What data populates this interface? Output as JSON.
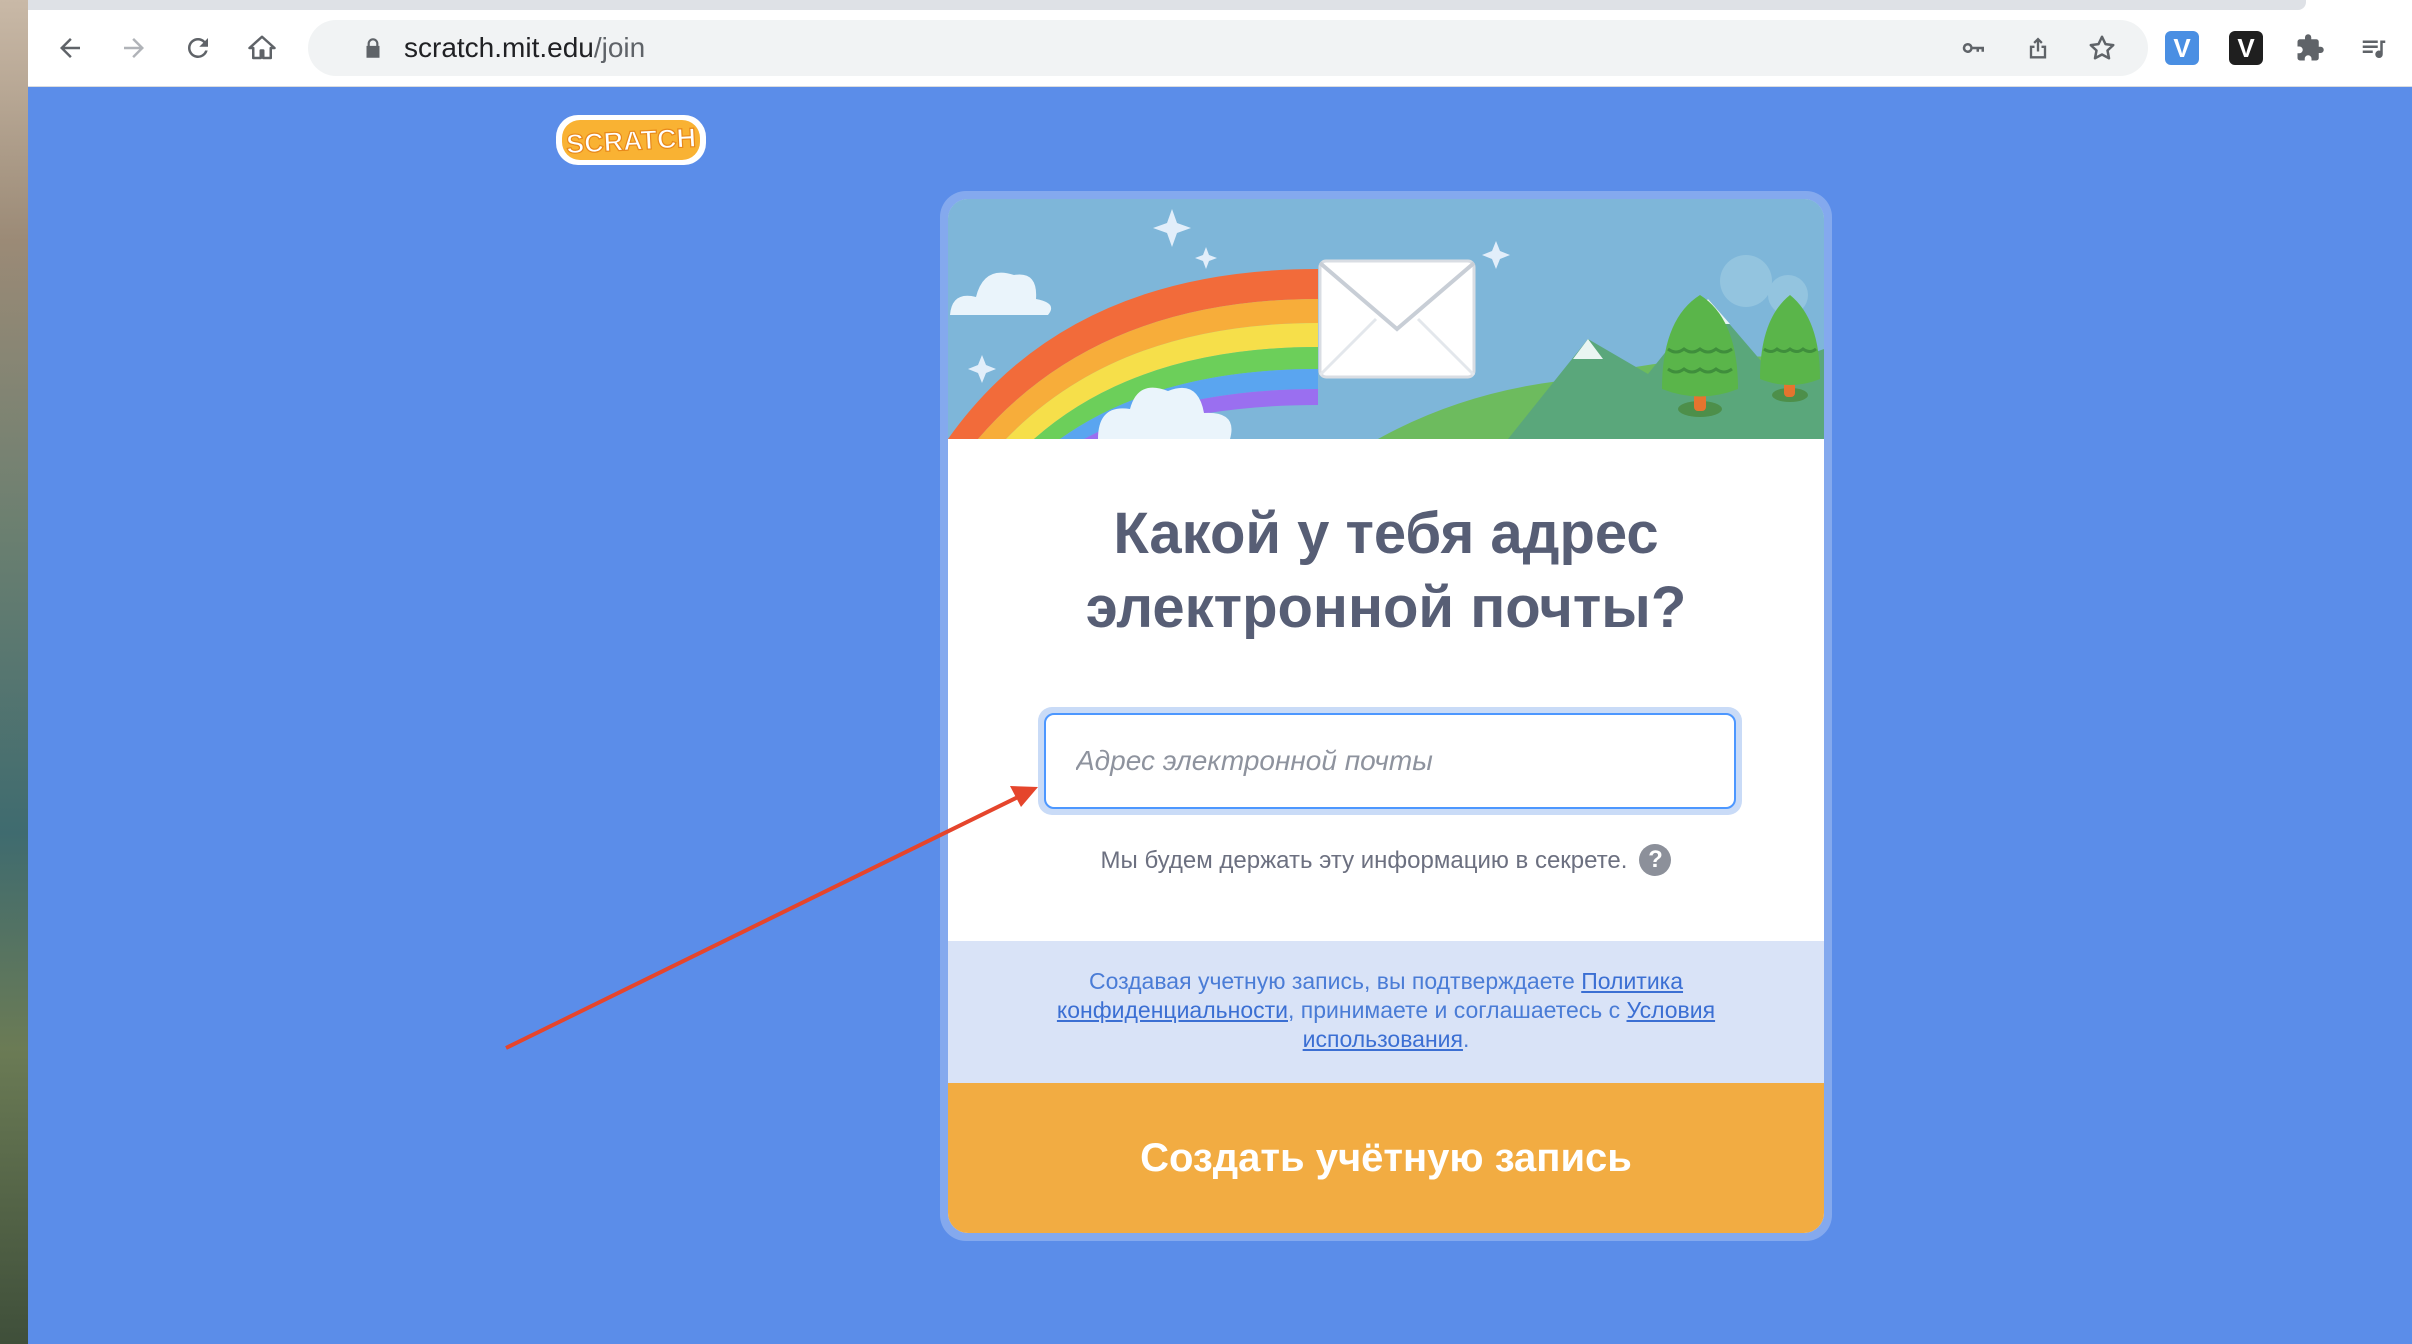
{
  "browser": {
    "url_host": "scratch.mit.edu",
    "url_path": "/join",
    "extensions": [
      {
        "name": "v-blue-extension",
        "label": "V"
      },
      {
        "name": "v-dark-extension",
        "label": "V"
      }
    ]
  },
  "page": {
    "logo_text": "SCRATCH",
    "headline_line1": "Какой у тебя адрес",
    "headline_line2": "электронной почты?",
    "email_placeholder": "Адрес электронной почты",
    "email_value": "",
    "privacy_note": "Мы будем держать эту информацию в секрете.",
    "help_label": "?",
    "terms_prefix": "Создавая учетную запись, вы подтверждаете ",
    "privacy_policy_link": "Политика конфиденциальности",
    "terms_middle": ", принимаете и соглашаетесь с ",
    "terms_of_use_link": "Условия использования",
    "terms_suffix": ".",
    "submit_label": "Создать учётную запись"
  },
  "colors": {
    "page_background": "#5b8de9",
    "submit_button": "#f2ac42",
    "terms_background": "#d9e3f7",
    "annotation_arrow": "#e5452c"
  }
}
